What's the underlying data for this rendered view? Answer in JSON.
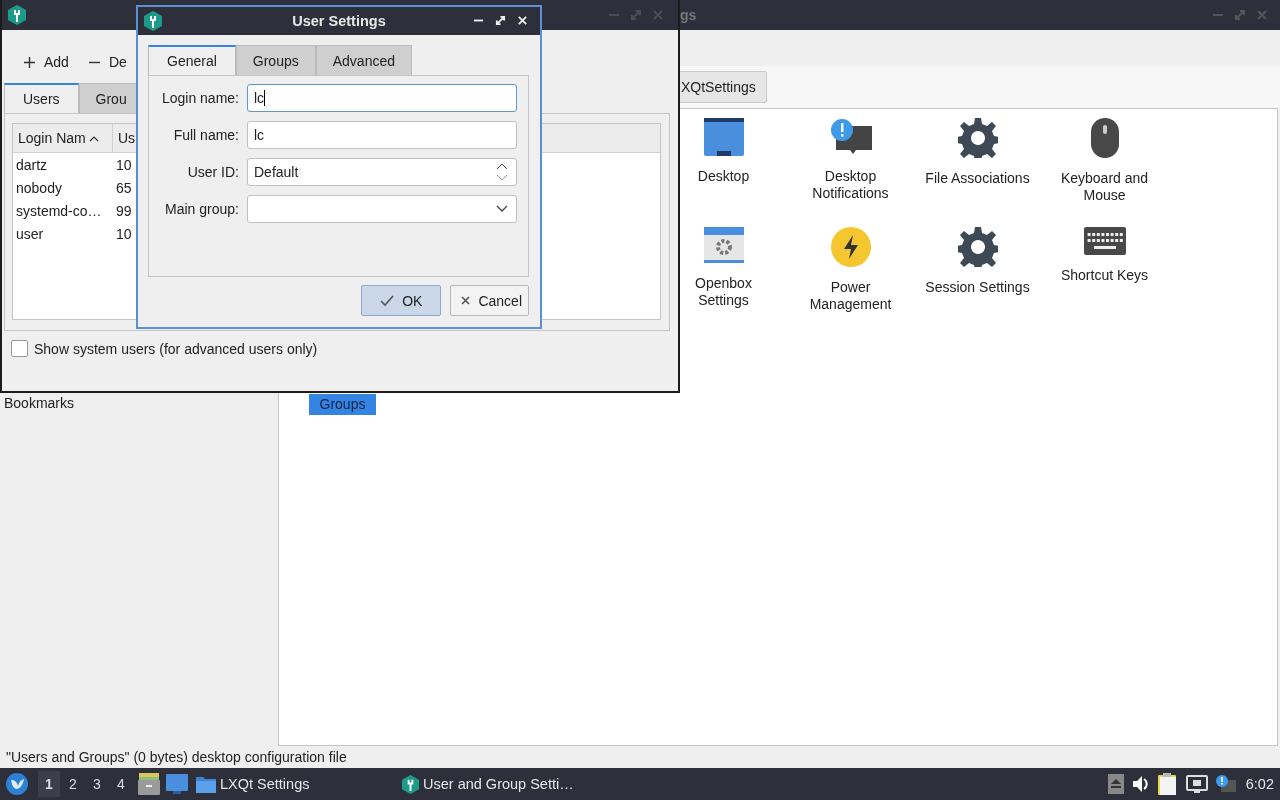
{
  "background_window": {
    "title": "gs",
    "breadcrumb": "XQtSettings",
    "sidebar_heading": "Bookmarks",
    "items": [
      {
        "label": "Desktop",
        "kind": "desktop",
        "selected": false
      },
      {
        "label": "Desktop Notifications",
        "kind": "notifications",
        "selected": false
      },
      {
        "label": "File Associations",
        "kind": "gear",
        "selected": false
      },
      {
        "label": "Keyboard and Mouse",
        "kind": "mouse",
        "selected": false
      },
      {
        "label": "Openbox Settings",
        "kind": "openbox",
        "selected": false
      },
      {
        "label": "Power Management",
        "kind": "power",
        "selected": false
      },
      {
        "label": "Session Settings",
        "kind": "gear",
        "selected": false
      },
      {
        "label": "Shortcut Keys",
        "kind": "keyboard",
        "selected": false
      },
      {
        "label": "Groups",
        "kind": "hidden",
        "selected": true
      }
    ],
    "status_bar": "\"Users and Groups\" (0 bytes) desktop configuration file"
  },
  "users_window": {
    "toolbar": [
      {
        "label": "Add",
        "kind": "add"
      },
      {
        "label": "De",
        "kind": "remove"
      }
    ],
    "tabs": [
      {
        "label": "Users",
        "selected": true
      },
      {
        "label": "Grou",
        "selected": false
      }
    ],
    "table": {
      "columns": [
        {
          "label": "Login Nam",
          "sorted": true
        },
        {
          "label": "Us",
          "sorted": false
        }
      ],
      "rows": [
        [
          "dartz",
          "10"
        ],
        [
          "nobody",
          "65"
        ],
        [
          "systemd-co…",
          "99"
        ],
        [
          "user",
          "10"
        ]
      ]
    },
    "show_system_users": {
      "label": "Show system users (for advanced users only)",
      "checked": false
    }
  },
  "dialog": {
    "title": "User Settings",
    "tabs": [
      {
        "label": "General",
        "selected": true
      },
      {
        "label": "Groups",
        "selected": false
      },
      {
        "label": "Advanced",
        "selected": false
      }
    ],
    "fields": [
      {
        "label": "Login name:",
        "kind": "text",
        "value": "lc",
        "focused": true
      },
      {
        "label": "Full name:",
        "kind": "text",
        "value": "lc",
        "focused": false
      },
      {
        "label": "User ID:",
        "kind": "spin",
        "value": "Default",
        "focused": false
      },
      {
        "label": "Main group:",
        "kind": "combo",
        "focused": false
      }
    ],
    "buttons": [
      {
        "label": "OK",
        "kind": "ok",
        "default": true
      },
      {
        "label": "Cancel",
        "kind": "cancel",
        "default": false
      }
    ]
  },
  "taskbar": {
    "desktops": [
      {
        "label": "1",
        "selected": true
      },
      {
        "label": "2",
        "selected": false
      },
      {
        "label": "3",
        "selected": false
      },
      {
        "label": "4",
        "selected": false
      }
    ],
    "tasks": [
      {
        "label": "LXQt Settings",
        "kind": "folder"
      },
      {
        "label": "User and Group Setti…",
        "kind": "app"
      }
    ],
    "clock": "6:02"
  }
}
